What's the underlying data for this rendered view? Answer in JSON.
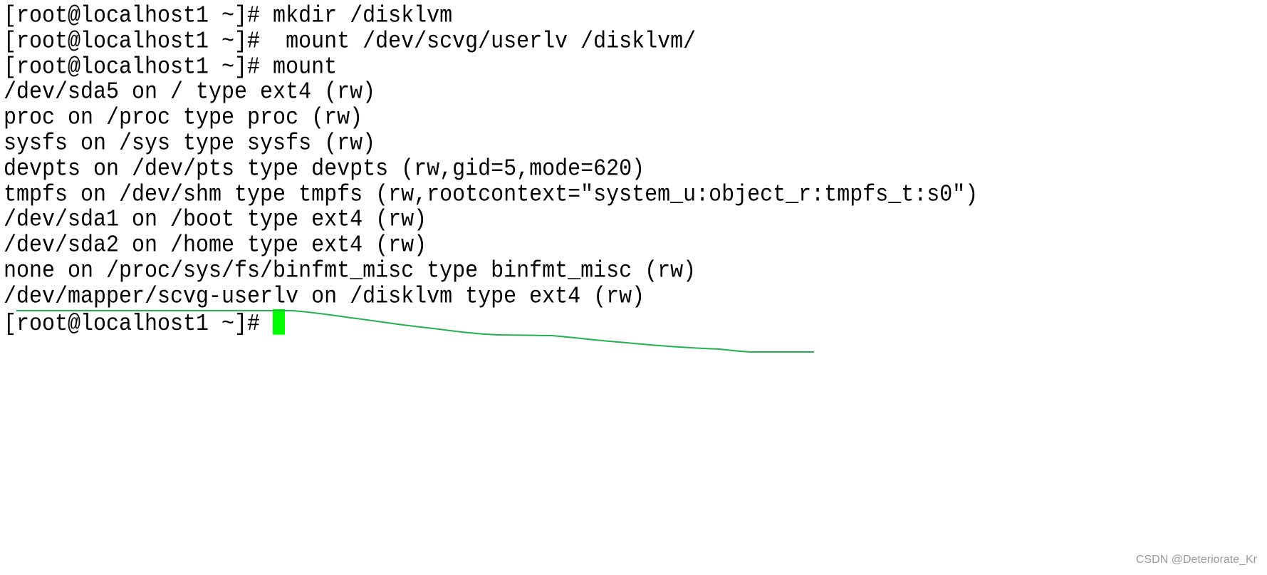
{
  "terminal": {
    "lines": [
      "[root@localhost1 ~]# mkdir /disklvm",
      "[root@localhost1 ~]#  mount /dev/scvg/userlv /disklvm/",
      "[root@localhost1 ~]# mount",
      "/dev/sda5 on / type ext4 (rw)",
      "proc on /proc type proc (rw)",
      "sysfs on /sys type sysfs (rw)",
      "devpts on /dev/pts type devpts (rw,gid=5,mode=620)",
      "tmpfs on /dev/shm type tmpfs (rw,rootcontext=\"system_u:object_r:tmpfs_t:s0\")",
      "/dev/sda1 on /boot type ext4 (rw)",
      "/dev/sda2 on /home type ext4 (rw)",
      "none on /proc/sys/fs/binfmt_misc type binfmt_misc (rw)",
      "/dev/mapper/scvg-userlv on /disklvm type ext4 (rw)"
    ],
    "prompt": "[root@localhost1 ~]# ",
    "cursor_color": "#00ff00",
    "annotation_color": "#22b14c"
  },
  "watermark": "CSDN @Deteriorate_Kr"
}
